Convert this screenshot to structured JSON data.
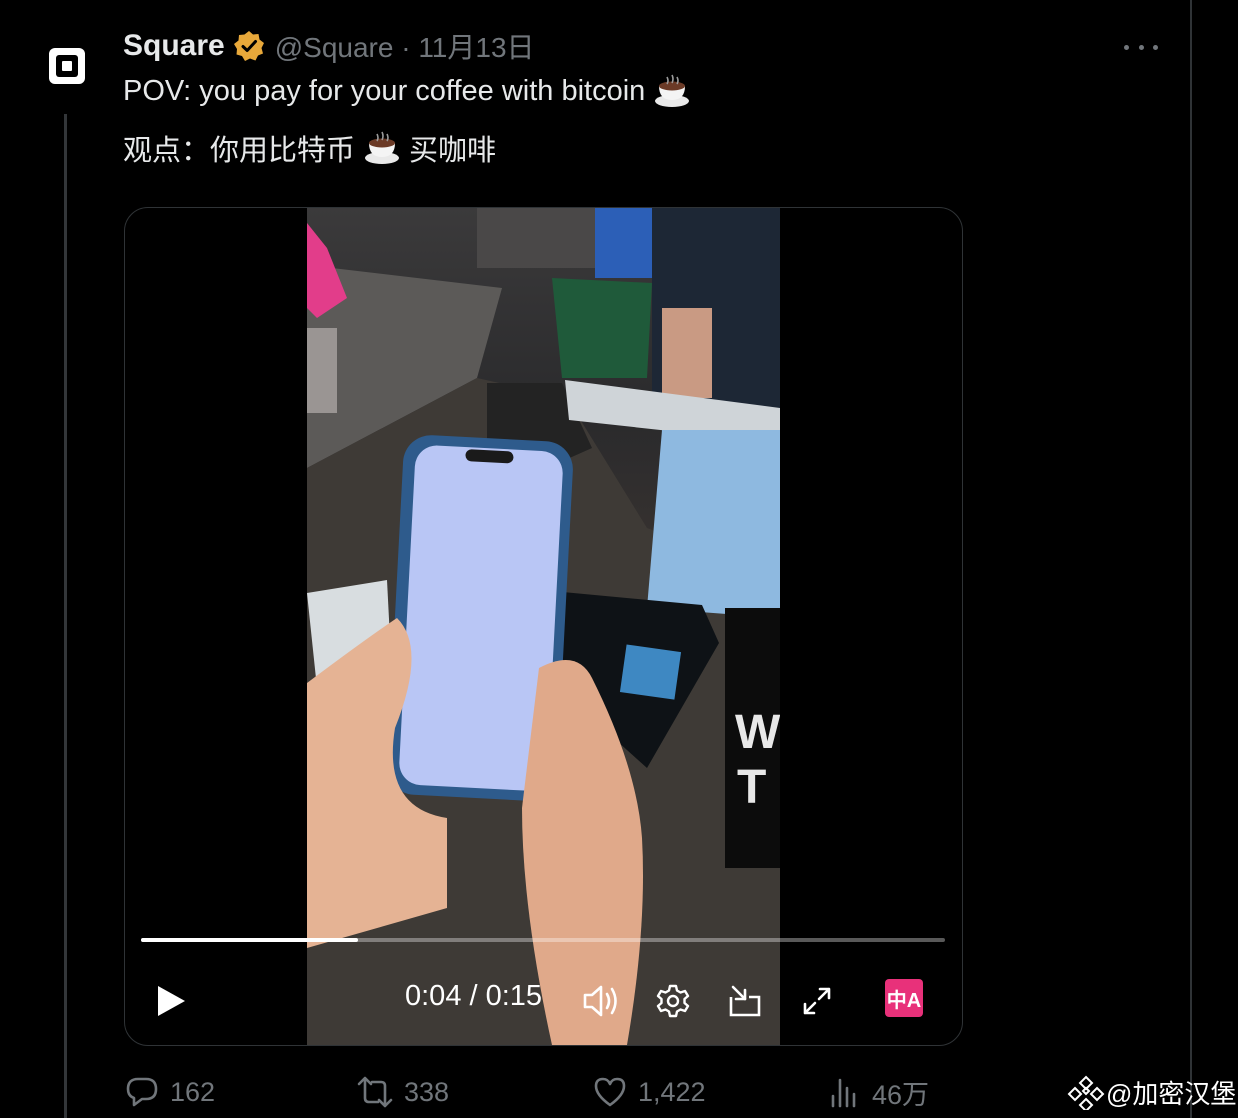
{
  "tweet": {
    "author_name": "Square",
    "handle_and_date": "@Square · 11月13日",
    "text_en": "POV: you pay for your coffee with bitcoin",
    "text_zh_before": "观点：你用比特币",
    "text_zh_after": "买咖啡",
    "emoji": "coffee-cup-icon"
  },
  "video": {
    "time_display": "0:04 / 0:15",
    "progress": 0.27,
    "translate_badge": "中A"
  },
  "actions": {
    "replies": "162",
    "retweets": "338",
    "likes": "1,422",
    "views": "46万"
  },
  "watermark": "@加密汉堡",
  "colors": {
    "background": "#000000",
    "text_primary": "#e7e9ea",
    "text_secondary": "#71767b",
    "verified_gold": "#e8a83a",
    "translate_pink": "#e8317a"
  }
}
